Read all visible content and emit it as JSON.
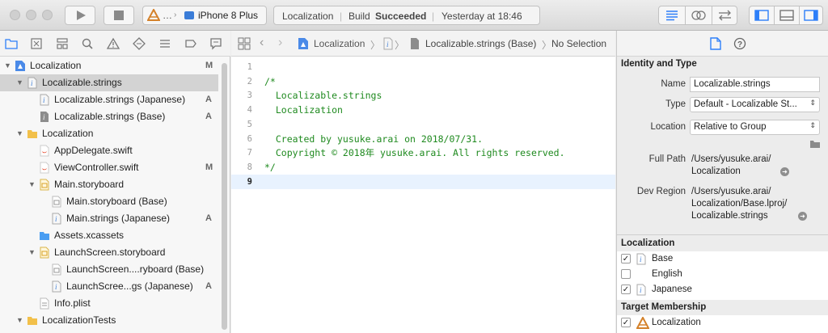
{
  "toolbar": {
    "scheme_target": "…",
    "scheme_device": "iPhone 8 Plus",
    "activity_project": "Localization",
    "activity_build": "Build",
    "activity_status": "Succeeded",
    "activity_time": "Yesterday at 18:46"
  },
  "navigator": {
    "items": [
      {
        "label": "Localization",
        "badge": "M"
      },
      {
        "label": "Localizable.strings",
        "badge": ""
      },
      {
        "label": "Localizable.strings (Japanese)",
        "badge": "A"
      },
      {
        "label": "Localizable.strings (Base)",
        "badge": "A"
      },
      {
        "label": "Localization",
        "badge": ""
      },
      {
        "label": "AppDelegate.swift",
        "badge": ""
      },
      {
        "label": "ViewController.swift",
        "badge": "M"
      },
      {
        "label": "Main.storyboard",
        "badge": ""
      },
      {
        "label": "Main.storyboard (Base)",
        "badge": ""
      },
      {
        "label": "Main.strings (Japanese)",
        "badge": "A"
      },
      {
        "label": "Assets.xcassets",
        "badge": ""
      },
      {
        "label": "LaunchScreen.storyboard",
        "badge": ""
      },
      {
        "label": "LaunchScreen....ryboard (Base)",
        "badge": ""
      },
      {
        "label": "LaunchScree...gs (Japanese)",
        "badge": "A"
      },
      {
        "label": "Info.plist",
        "badge": ""
      },
      {
        "label": "LocalizationTests",
        "badge": ""
      }
    ]
  },
  "jumpbar": {
    "project": "Localization",
    "file": "Localizable.strings (Base)",
    "selection": "No Selection"
  },
  "editor": {
    "lines": [
      {
        "num": "1",
        "code": ""
      },
      {
        "num": "2",
        "code": "/*"
      },
      {
        "num": "3",
        "code": "  Localizable.strings"
      },
      {
        "num": "4",
        "code": "  Localization"
      },
      {
        "num": "5",
        "code": ""
      },
      {
        "num": "6",
        "code": "  Created by yusuke.arai on 2018/07/31."
      },
      {
        "num": "7",
        "code": "  Copyright © 2018年 yusuke.arai. All rights reserved."
      },
      {
        "num": "8",
        "code": "*/"
      },
      {
        "num": "9",
        "code": ""
      }
    ]
  },
  "inspector": {
    "identity_header": "Identity and Type",
    "name_label": "Name",
    "name_value": "Localizable.strings",
    "type_label": "Type",
    "type_value": "Default - Localizable St...",
    "location_label": "Location",
    "location_value": "Relative to Group",
    "fullpath_label": "Full Path",
    "fullpath_line1": "/Users/yusuke.arai/",
    "fullpath_line2": "Localization",
    "devregion_label": "Dev Region",
    "devregion_line1": "/Users/yusuke.arai/",
    "devregion_line2": "Localization/Base.lproj/",
    "devregion_line3": "Localizable.strings",
    "localization_header": "Localization",
    "localizations": [
      {
        "label": "Base",
        "checked": "✓"
      },
      {
        "label": "English",
        "checked": ""
      },
      {
        "label": "Japanese",
        "checked": "✓"
      }
    ],
    "target_header": "Target Membership",
    "targets": [
      {
        "label": "Localization",
        "checked": "✓"
      }
    ]
  },
  "colors": {
    "accent": "#2d7ff9",
    "comment_green": "#1f8a1f",
    "selection_gray": "#d3d3d3"
  }
}
